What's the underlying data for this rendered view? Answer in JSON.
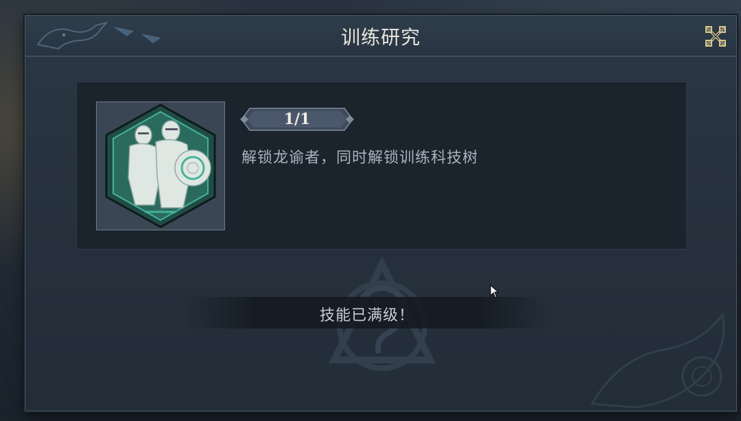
{
  "window": {
    "title": "训练研究",
    "close_icon": "close-x-icon"
  },
  "skill": {
    "icon": "armored-knights-shield-icon",
    "level": "1/1",
    "description": "解锁龙谕者，同时解锁训练科技树"
  },
  "status": {
    "message": "技能已满级！"
  },
  "colors": {
    "panel": "#26313d",
    "card": "#1b232d",
    "title_text": "#e8e6dc",
    "accent_teal": "#2fa58a",
    "close_gold": "#d9c98e"
  }
}
